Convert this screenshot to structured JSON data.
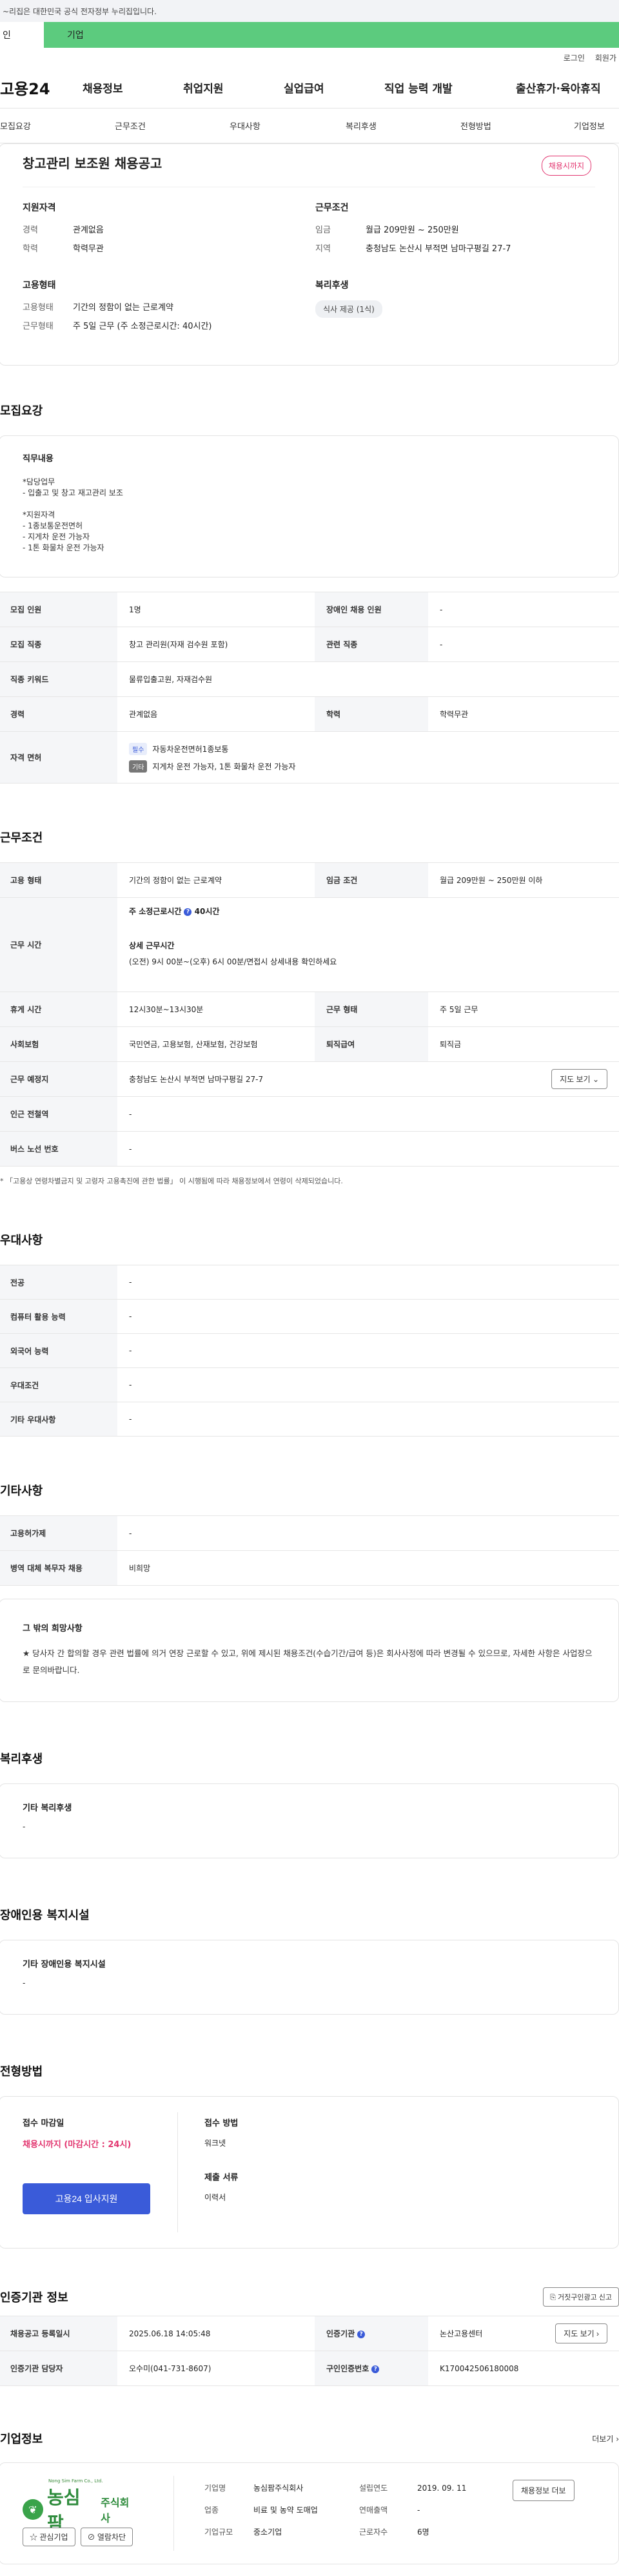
{
  "gov_bar": {
    "text": "~리집은 대한민국 공식 전자정부 누리집입니다."
  },
  "tabs": {
    "person": "인",
    "corp": "기업"
  },
  "util": {
    "login": "로그인",
    "join": "회원가"
  },
  "gnb": {
    "logo": "고용24",
    "items": [
      "채용정보",
      "취업지원",
      "실업급여",
      "직업 능력 개발",
      "출산휴가·육아휴직"
    ]
  },
  "subnav": [
    "모집요강",
    "근무조건",
    "우대사항",
    "복리후생",
    "전형방법",
    "기업정보"
  ],
  "summary": {
    "title": "창고관리 보조원 채용공고",
    "badge": "채용시까지",
    "qual": {
      "heading": "지원자격",
      "career_k": "경력",
      "career_v": "관계없음",
      "edu_k": "학력",
      "edu_v": "학력무관"
    },
    "cond": {
      "heading": "근무조건",
      "pay_k": "임금",
      "pay_v": "월급 209만원 ~ 250만원",
      "loc_k": "지역",
      "loc_v": "충청남도 논산시 부적면 남마구평길 27-7"
    },
    "emp": {
      "heading": "고용형태",
      "type_k": "고용형태",
      "type_v": "기간의 정함이 없는 근로계약",
      "hours_k": "근무형태",
      "hours_v": "주 5일 근무 (주 소정근로시간: 40시간)"
    },
    "welfare": {
      "heading": "복리후생",
      "chip": "식사 제공 (1식)"
    }
  },
  "recruit": {
    "title": "모집요강",
    "duty_h": "직무내용",
    "duty_lines": [
      "*담당업무",
      "- 입출고 및 창고 재고관리 보조",
      "",
      "*지원자격",
      "- 1종보통운전면허",
      "- 지게차 운전 가능자",
      "- 1톤 화물차 운전 가능자"
    ],
    "rows": {
      "count_k": "모집 인원",
      "count_v": "1명",
      "disabled_k": "장애인 채용 인원",
      "disabled_v": "-",
      "job_k": "모집 직종",
      "job_v": "창고 관리원(자재 검수원 포함)",
      "rel_k": "관련 직종",
      "rel_v": "-",
      "kw_k": "직종 키워드",
      "kw_v": "물류입출고원, 자재검수원",
      "exp_k": "경력",
      "exp_v": "관계없음",
      "edu_k": "학력",
      "edu_v": "학력무관",
      "lic_k": "자격 면허",
      "lic_tag1": "필수",
      "lic_v1": "자동차운전면허1종보통",
      "lic_tag2": "기타",
      "lic_v2": "지게차 운전 가능자, 1톤 화물차 운전 가능자"
    }
  },
  "workcond": {
    "title": "근무조건",
    "emp_k": "고용 형태",
    "emp_v": "기간의 정함이 없는 근로계약",
    "pay_k": "임금 조건",
    "pay_v": "월급 209만원 ~ 250만원 이하",
    "time_k": "근무 시간",
    "time_week": "주 소정근로시간",
    "time_week_v": "40시간",
    "time_detail_h": "상세 근무시간",
    "time_detail_v": "(오전) 9시 00분~(오후) 6시 00분/면접시 상세내용 확인하세요",
    "rest_k": "휴게 시간",
    "rest_v": "12시30분~13시30분",
    "form_k": "근무 형태",
    "form_v": "주 5일 근무",
    "ins_k": "사회보험",
    "ins_v": "국민연금, 고용보험, 산재보험, 건강보험",
    "ret_k": "퇴직급여",
    "ret_v": "퇴직금",
    "place_k": "근무 예정지",
    "place_v": "충청남도 논산시 부적면 남마구평길 27-7",
    "map_btn": "지도 보기",
    "subway_k": "인근 전철역",
    "subway_v": "-",
    "bus_k": "버스 노선 번호",
    "bus_v": "-",
    "note": "* 「고용상 연령차별금지 및 고령자 고용촉진에 관한 법률」 이 시행됨에 따라 채용정보에서 연령이 삭제되었습니다."
  },
  "pref": {
    "title": "우대사항",
    "rows": [
      {
        "k": "전공",
        "v": "-"
      },
      {
        "k": "컴퓨터 활용 능력",
        "v": "-"
      },
      {
        "k": "외국어 능력",
        "v": "-"
      },
      {
        "k": "우대조건",
        "v": "-"
      },
      {
        "k": "기타 우대사항",
        "v": "-"
      }
    ]
  },
  "etc": {
    "title": "기타사항",
    "rows": [
      {
        "k": "고용허가제",
        "v": "-"
      },
      {
        "k": "병역 대체 복무자 채용",
        "v": "비희망"
      }
    ],
    "box_h": "그 밖의 희망사항",
    "box_v": "★ 당사자 간 합의할 경우 관련 법률에 의거 연장 근로할 수 있고, 위에 제시된 채용조건(수습기간/급여 등)은 회사사정에 따라 변경될 수 있으므로, 자세한 사항은 사업장으로 문의바랍니다."
  },
  "welfare": {
    "title": "복리후생",
    "h": "기타 복리후생",
    "v": "-"
  },
  "disab": {
    "title": "장애인용 복지시설",
    "h": "기타 장애인용 복지시설",
    "v": "-"
  },
  "process": {
    "title": "전형방법",
    "deadline_h": "접수 마감일",
    "deadline_v": "채용시까지 (마감시간 : 24시)",
    "apply_btn": "고용24 입사지원",
    "method_h": "접수 방법",
    "method_v": "워크넷",
    "docs_h": "제출 서류",
    "docs_v": "이력서"
  },
  "cert": {
    "title": "인증기관 정보",
    "report_btn": "거짓구인광고 신고",
    "reg_k": "채용공고 등록일시",
    "reg_v": "2025.06.18 14:05:48",
    "org_k": "인증기관",
    "org_v": "논산고용센터",
    "map_btn": "지도 보기",
    "mgr_k": "인증기관 담당자",
    "mgr_v": "오수미(041-731-8607)",
    "id_k": "구인인증번호",
    "id_v": "K170042506180008"
  },
  "company": {
    "title": "기업정보",
    "more": "더보기",
    "logo_small": "Nong Sim Farm Co., Ltd.",
    "logo_name": "농심팜",
    "logo_suffix": "주식회사",
    "fav_btn": "관심기업",
    "block_btn": "열람차단",
    "name_k": "기업명",
    "name_v": "농심팜주식회사",
    "found_k": "설립연도",
    "found_v": "2019. 09. 11",
    "biz_k": "업종",
    "biz_v": "비료 및 농약 도매업",
    "sales_k": "연매출액",
    "sales_v": "-",
    "emp_k": "근로자수",
    "emp_v": "6명",
    "size_k": "기업규모",
    "size_v": "중소기업",
    "jobs_btn": "채용정보 더보"
  }
}
